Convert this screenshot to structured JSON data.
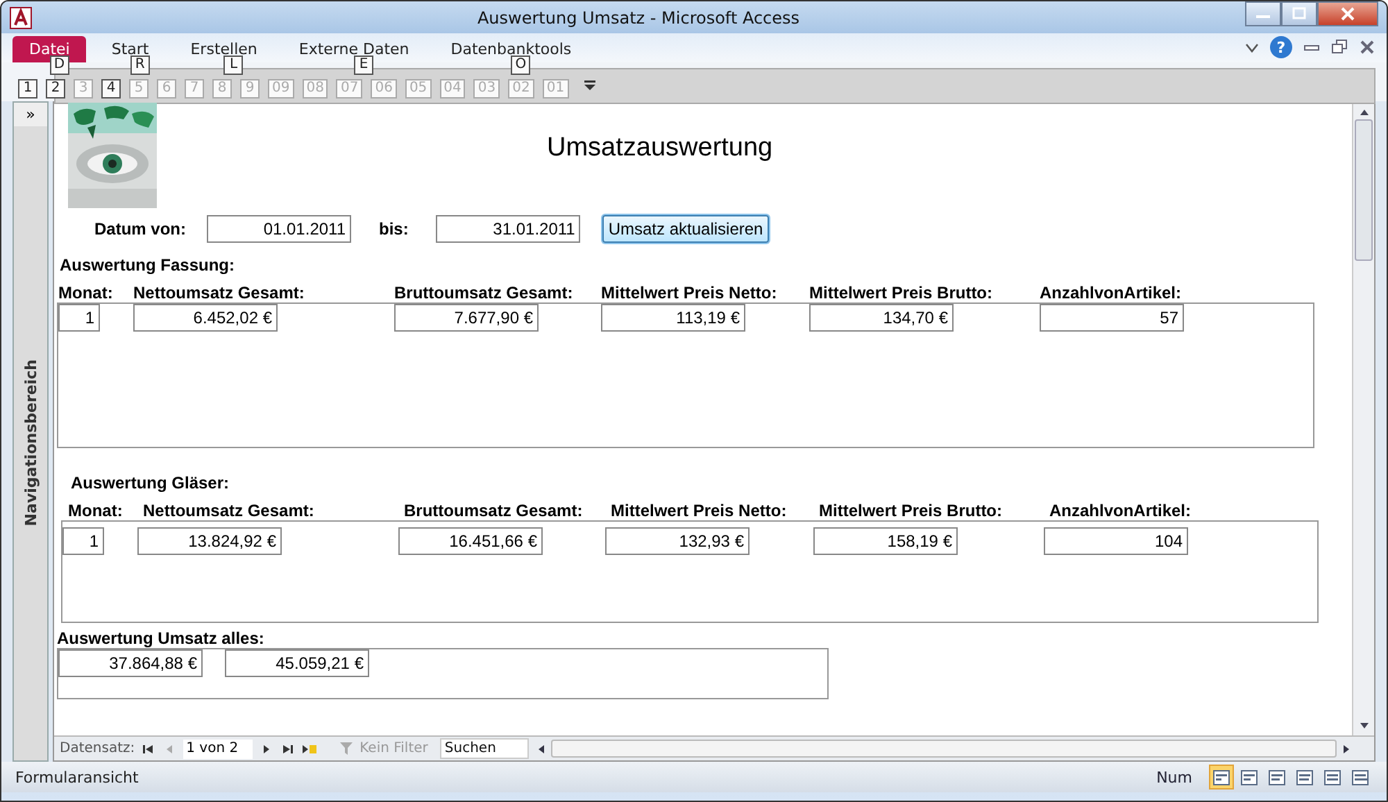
{
  "window": {
    "title": "Auswertung Umsatz - Microsoft Access"
  },
  "ribbon_tabs": [
    {
      "label": "Datei",
      "selected": true,
      "keytip": "D"
    },
    {
      "label": "Start",
      "selected": false,
      "keytip": "R"
    },
    {
      "label": "Erstellen",
      "selected": false,
      "keytip": "L"
    },
    {
      "label": "Externe Daten",
      "selected": false,
      "keytip": "E"
    },
    {
      "label": "Datenbanktools",
      "selected": false,
      "keytip": "O"
    }
  ],
  "help_button": "?",
  "quick_access_keytips": [
    {
      "label": "1",
      "disabled": false
    },
    {
      "label": "2",
      "disabled": false
    },
    {
      "label": "3",
      "disabled": true
    },
    {
      "label": "4",
      "disabled": false
    },
    {
      "label": "5",
      "disabled": true
    },
    {
      "label": "6",
      "disabled": true
    },
    {
      "label": "7",
      "disabled": true
    },
    {
      "label": "8",
      "disabled": true
    },
    {
      "label": "9",
      "disabled": true
    },
    {
      "label": "09",
      "disabled": true
    },
    {
      "label": "08",
      "disabled": true
    },
    {
      "label": "07",
      "disabled": true
    },
    {
      "label": "06",
      "disabled": true
    },
    {
      "label": "05",
      "disabled": true
    },
    {
      "label": "04",
      "disabled": true
    },
    {
      "label": "03",
      "disabled": true
    },
    {
      "label": "02",
      "disabled": true
    },
    {
      "label": "01",
      "disabled": true
    }
  ],
  "navigation_pane": {
    "toggle": "»",
    "label": "Navigationsbereich"
  },
  "form": {
    "title": "Umsatzauswertung",
    "date_from_label": "Datum von:",
    "date_from": "01.01.2011",
    "date_to_label": "bis:",
    "date_to": "31.01.2011",
    "update_button": "Umsatz aktualisieren",
    "sections": [
      {
        "title": "Auswertung Fassung:",
        "columns": [
          "Monat:",
          "Nettoumsatz Gesamt:",
          "Bruttoumsatz Gesamt:",
          "Mittelwert Preis Netto:",
          "Mittelwert Preis Brutto:",
          "AnzahlvonArtikel:"
        ],
        "values": [
          "1",
          "6.452,02 €",
          "7.677,90 €",
          "113,19 €",
          "134,70 €",
          "57"
        ]
      },
      {
        "title": "Auswertung Gläser:",
        "columns": [
          "Monat:",
          "Nettoumsatz Gesamt:",
          "Bruttoumsatz Gesamt:",
          "Mittelwert Preis Netto:",
          "Mittelwert Preis Brutto:",
          "AnzahlvonArtikel:"
        ],
        "values": [
          "1",
          "13.824,92 €",
          "16.451,66 €",
          "132,93 €",
          "158,19 €",
          "104"
        ]
      }
    ],
    "total": {
      "title": "Auswertung Umsatz alles:",
      "values": [
        "37.864,88 €",
        "45.059,21 €"
      ]
    }
  },
  "record_navigator": {
    "label": "Datensatz:",
    "position": "1 von 2",
    "filter": "Kein Filter",
    "search_placeholder": "Suchen"
  },
  "status_bar": {
    "text": "Formularansicht",
    "num": "Num",
    "views": [
      {
        "selected": true
      },
      {
        "selected": false
      },
      {
        "selected": false
      },
      {
        "selected": false
      },
      {
        "selected": false
      },
      {
        "selected": false
      }
    ]
  }
}
